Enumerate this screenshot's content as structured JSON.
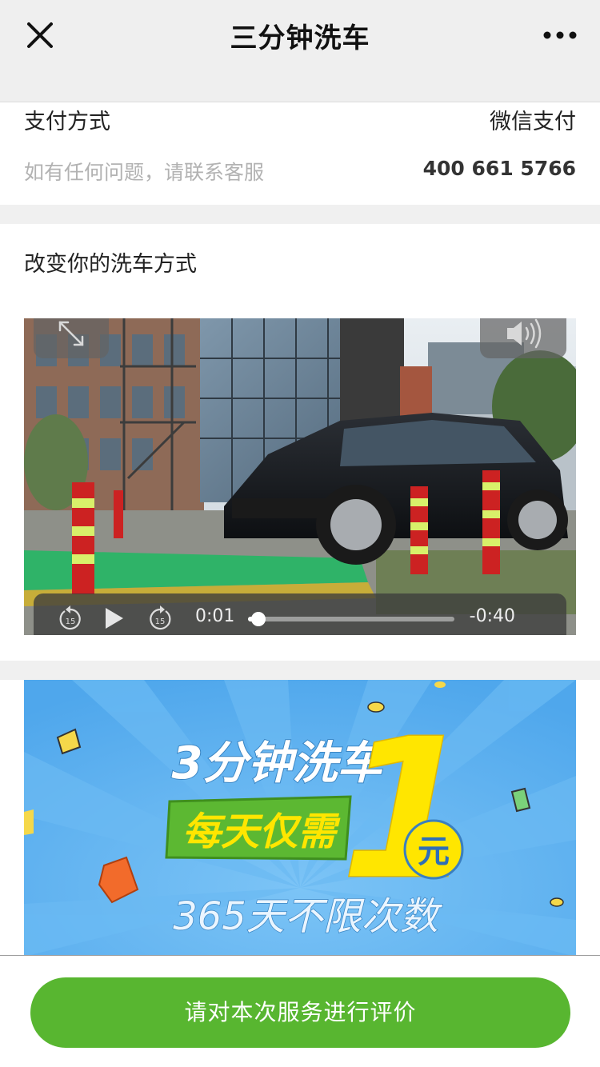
{
  "nav": {
    "title": "三分钟洗车"
  },
  "payment": {
    "method_label": "支付方式",
    "method_value": "微信支付",
    "help_text": "如有任何问题，请联系客服",
    "phone": "400 661 5766"
  },
  "video_section": {
    "title": "改变你的洗车方式",
    "current_time": "0:01",
    "remaining_time": "-0:40",
    "skip_seconds": "15",
    "progress": 0.05
  },
  "banner": {
    "line1": "3分钟洗车",
    "line2": "每天仅需",
    "big_number": "1",
    "unit": "元",
    "line3": "365天不限次数"
  },
  "bottom": {
    "rate_button": "请对本次服务进行评价"
  },
  "colors": {
    "accent_green": "#58b630",
    "banner_blue": "#5aaef0",
    "banner_yellow": "#ffe600"
  }
}
